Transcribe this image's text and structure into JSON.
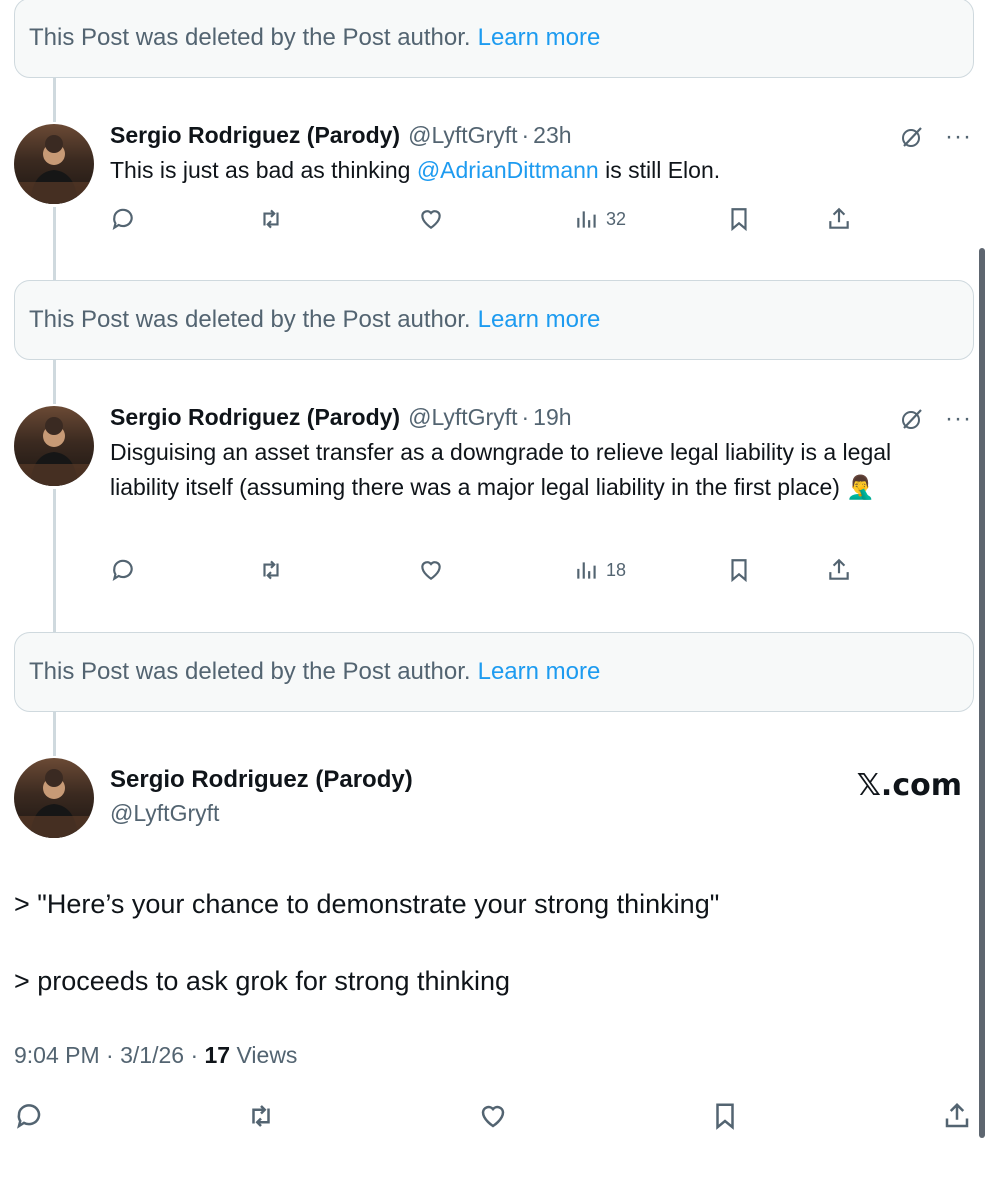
{
  "deleted_notice": {
    "text": "This Post was deleted by the Post author.",
    "link": "Learn more"
  },
  "replies": [
    {
      "name": "Sergio Rodriguez (Parody)",
      "handle": "@LyftGryft",
      "time": "23h",
      "text_before": "This is just as bad as thinking ",
      "mention": "@AdrianDittmann",
      "text_after": " is still Elon.",
      "views": "32"
    },
    {
      "name": "Sergio Rodriguez (Parody)",
      "handle": "@LyftGryft",
      "time": "19h",
      "text": "Disguising an asset transfer as a downgrade to relieve legal liability is a legal liability itself (assuming there was a major legal liability in the first place) 🤦‍♂️",
      "views": "18"
    }
  ],
  "main_post": {
    "name": "Sergio Rodriguez (Parody)",
    "handle": "@LyftGryft",
    "source": "𝕏.com",
    "line1": "> \"Here’s your chance to demonstrate your strong thinking\"",
    "line2": "> proceeds to ask grok for strong thinking",
    "time": "9:04 PM",
    "date": "3/1/26",
    "views_count": "17",
    "views_label": "Views"
  },
  "icons": [
    "reply-icon",
    "retweet-icon",
    "like-icon",
    "views-icon",
    "bookmark-icon",
    "share-icon",
    "grok-icon",
    "more-icon"
  ]
}
